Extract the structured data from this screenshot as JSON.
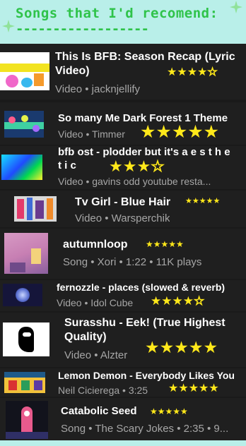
{
  "header": {
    "title": "Songs that I'd recomend:",
    "dashes": "------------------",
    "colors": {
      "background": "#b9efe9",
      "text": "#2fc34a",
      "sparkle": "#90e29a"
    }
  },
  "items": [
    {
      "title_line1": "This Is BFB: Season Recap (Lyric",
      "title_line2": "Video)",
      "meta": "Video • jacknjellify",
      "stars": "★★★★",
      "stars_extra": "☆",
      "rating": 4.5
    },
    {
      "title_line1": "So many Me Dark Forest 1 Theme",
      "meta": "Video • Timmer",
      "stars": "★★★★★",
      "rating": 5
    },
    {
      "title_line1": "bfb ost - plodder but it's a e s t h e",
      "title_line2": "t i c",
      "meta": "Video • gavins odd youtube resta...",
      "stars": "★★★",
      "stars_extra": "☆",
      "rating": 3
    },
    {
      "title_line1": "Tv Girl - Blue Hair",
      "meta": "Video • Warsperchik",
      "stars": "★★★★★",
      "rating": 5
    },
    {
      "title_line1": "autumnloop",
      "meta": "Song • Xori • 1:22 • 11K plays",
      "stars": "★★★★★",
      "rating": 5
    },
    {
      "title_line1": "fernozzle - places (slowed & reverb)",
      "meta": "Video • Idol Cube",
      "stars": "★★★★",
      "stars_extra": "☆",
      "rating": 4.5
    },
    {
      "title_line1": "Surasshu - Eek! (True Highest",
      "title_line2": "Quality)",
      "meta": "Video • Alzter",
      "stars": "★★★★★",
      "rating": 5
    },
    {
      "title_line1": "Lemon Demon - Everybody Likes You",
      "meta": "Neil Cicierega • 3:25",
      "stars": "★★★★★",
      "rating": 5
    },
    {
      "title_line1": "Catabolic Seed",
      "meta": "Song • The Scary Jokes • 2:35 • 9...",
      "stars": "★★★★★",
      "rating": 5
    }
  ]
}
